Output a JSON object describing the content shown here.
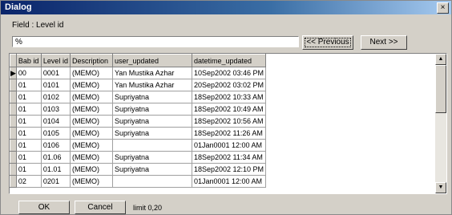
{
  "window": {
    "title": "Dialog",
    "close_glyph": "×"
  },
  "field_label": "Field : Level id",
  "filter": {
    "value": "%"
  },
  "buttons": {
    "previous": "<< Previous",
    "next": "Next >>",
    "ok": "OK",
    "cancel": "Cancel"
  },
  "status": {
    "limit_text": "limit 0,20"
  },
  "grid": {
    "columns": [
      "Bab id",
      "Level id",
      "Description",
      "user_updated",
      "datetime_updated"
    ],
    "current_row_marker": "▶",
    "rows": [
      [
        "00",
        "0001",
        "(MEMO)",
        "Yan Mustika Azhar",
        "10Sep2002  03:46 PM"
      ],
      [
        "01",
        "0101",
        "(MEMO)",
        "Yan Mustika Azhar",
        "20Sep2002  03:02 PM"
      ],
      [
        "01",
        "0102",
        "(MEMO)",
        "Supriyatna",
        "18Sep2002  10:33 AM"
      ],
      [
        "01",
        "0103",
        "(MEMO)",
        "Supriyatna",
        "18Sep2002  10:49 AM"
      ],
      [
        "01",
        "0104",
        "(MEMO)",
        "Supriyatna",
        "18Sep2002  10:56 AM"
      ],
      [
        "01",
        "0105",
        "(MEMO)",
        "Supriyatna",
        "18Sep2002  11:26 AM"
      ],
      [
        "01",
        "0106",
        "(MEMO)",
        "",
        "01Jan0001  12:00 AM"
      ],
      [
        "01",
        "01.06",
        "(MEMO)",
        "Supriyatna",
        "18Sep2002  11:34 AM"
      ],
      [
        "01",
        "01.01",
        "(MEMO)",
        "Supriyatna",
        "18Sep2002  12:10 PM"
      ],
      [
        "02",
        "0201",
        "(MEMO)",
        "",
        "01Jan0001  12:00 AM"
      ]
    ]
  },
  "scrollbar": {
    "up_glyph": "▲",
    "down_glyph": "▼"
  }
}
